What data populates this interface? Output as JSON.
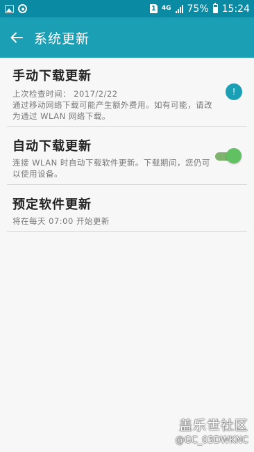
{
  "status_bar": {
    "sim": "1",
    "network": "4G",
    "battery": "75%",
    "time": "15:24"
  },
  "app_bar": {
    "title": "系统更新",
    "back_icon": "arrow-left-icon"
  },
  "items": [
    {
      "title": "手动下载更新",
      "subtitle": "上次检查时间： 2017/2/22\n通过移动网络下载可能产生额外费用。如有可能，请改为通过 WLAN 网络下载。",
      "badge": "!"
    },
    {
      "title": "自动下载更新",
      "subtitle": "连接 WLAN 时自动下载软件更新。下载期间，您仍可以使用设备。",
      "toggle": "on"
    },
    {
      "title": "预定软件更新",
      "subtitle": "将在每天 07:00 开始更新"
    }
  ],
  "watermark": {
    "line1": "盖乐世社区",
    "line2": "@GC_03DWKNC"
  },
  "colors": {
    "status_bar": "#0a8ba3",
    "app_bar": "#1a9fb5",
    "toggle_on": "#61c162"
  }
}
